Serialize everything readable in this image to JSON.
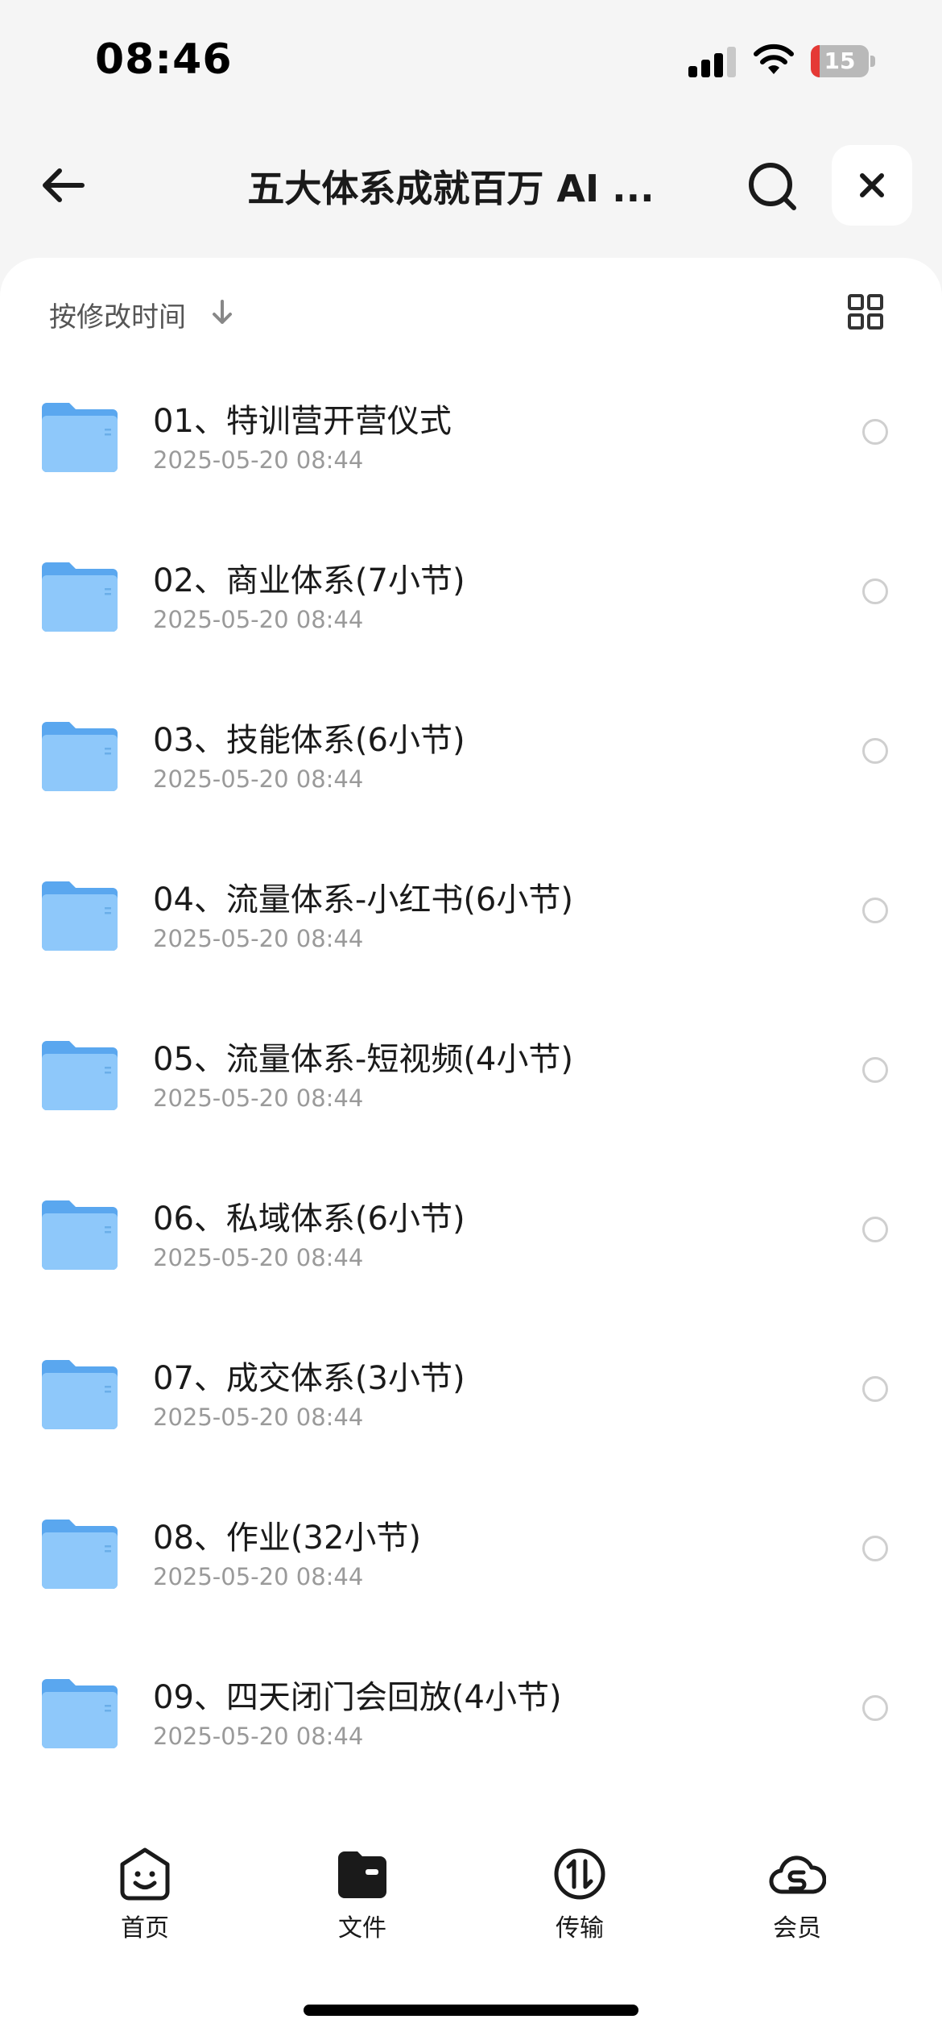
{
  "status_bar": {
    "time": "08:46",
    "battery_level": "15",
    "battery_color": "#e53935"
  },
  "header": {
    "title": "五大体系成就百万 AI ..."
  },
  "sort": {
    "label": "按修改时间"
  },
  "files": [
    {
      "name": "01、特训营开营仪式",
      "date": "2025-05-20 08:44"
    },
    {
      "name": "02、商业体系(7小节)",
      "date": "2025-05-20 08:44"
    },
    {
      "name": "03、技能体系(6小节)",
      "date": "2025-05-20 08:44"
    },
    {
      "name": "04、流量体系-小红书(6小节)",
      "date": "2025-05-20 08:44"
    },
    {
      "name": "05、流量体系-短视频(4小节)",
      "date": "2025-05-20 08:44"
    },
    {
      "name": "06、私域体系(6小节)",
      "date": "2025-05-20 08:44"
    },
    {
      "name": "07、成交体系(3小节)",
      "date": "2025-05-20 08:44"
    },
    {
      "name": "08、作业(32小节)",
      "date": "2025-05-20 08:44"
    },
    {
      "name": "09、四天闭门会回放(4小节)",
      "date": "2025-05-20 08:44"
    }
  ],
  "tabs": [
    {
      "label": "首页",
      "icon": "smiley-face-icon"
    },
    {
      "label": "文件",
      "icon": "folder-filled-icon"
    },
    {
      "label": "传输",
      "icon": "transfer-arrows-icon"
    },
    {
      "label": "会员",
      "icon": "cloud-s-icon"
    }
  ],
  "colors": {
    "folder": "#6fb6f5",
    "accent": "#1a1a1a"
  }
}
